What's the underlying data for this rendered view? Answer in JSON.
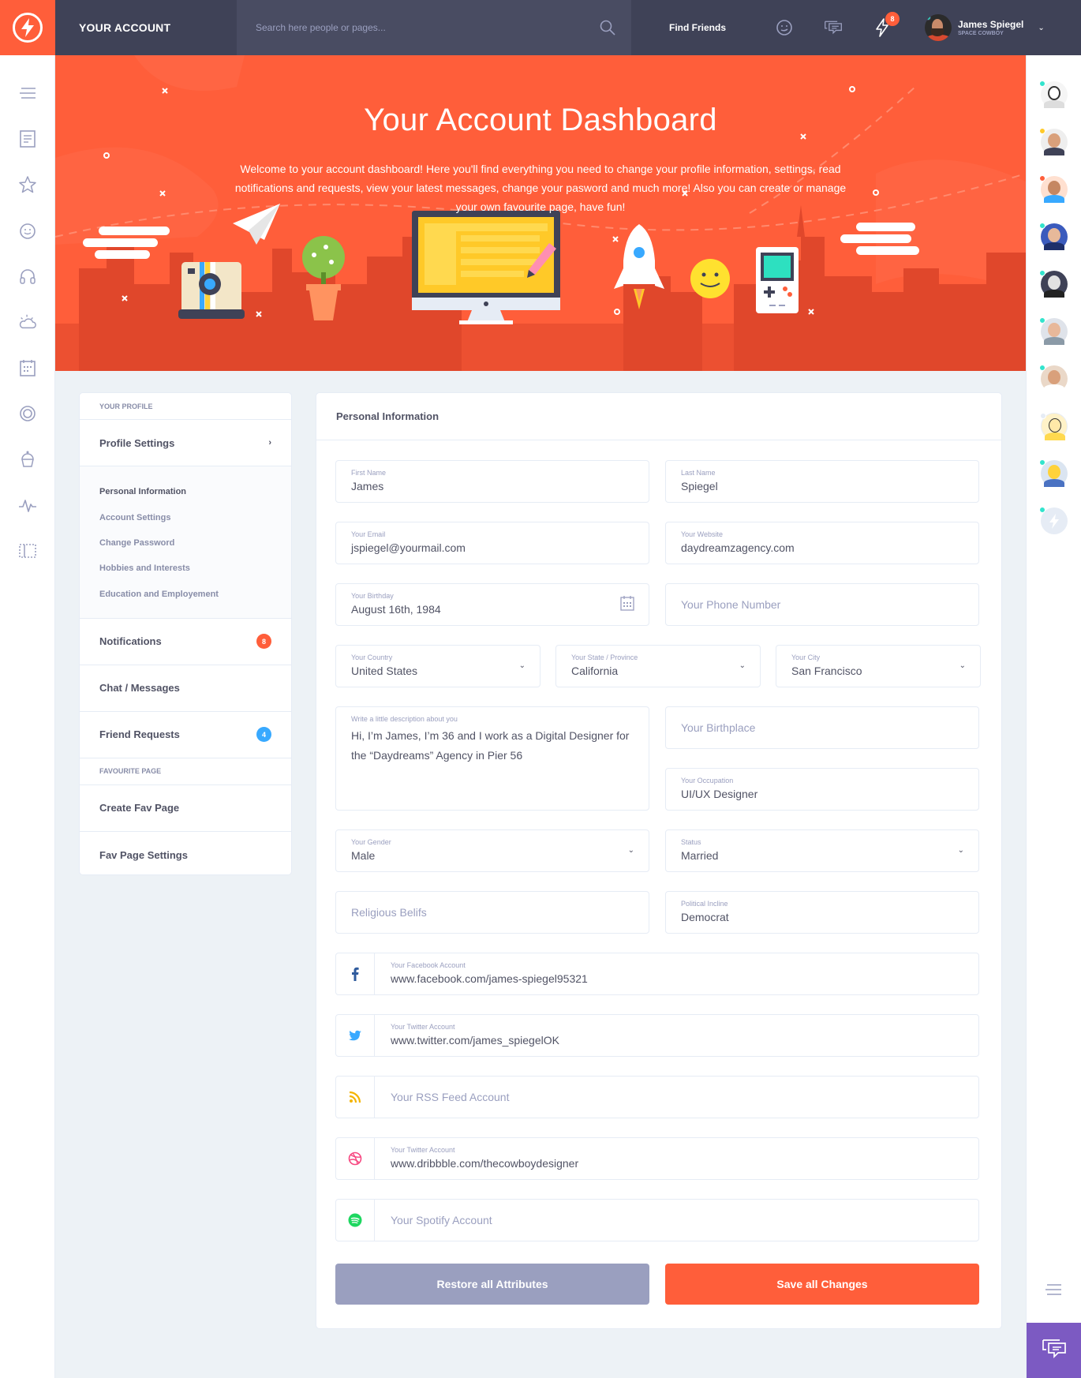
{
  "header": {
    "title": "YOUR ACCOUNT",
    "search_placeholder": "Search here people or pages...",
    "find_friends": "Find Friends",
    "notifications_count": "8",
    "user": {
      "name": "James Spiegel",
      "status": "SPACE COWBOY"
    }
  },
  "hero": {
    "title": "Your Account Dashboard",
    "text": "Welcome to your account dashboard! Here you'll find everything you need to change your profile information, settings, read notifications and requests, view your latest messages, change your pasword and much more! Also you can create or manage your own favourite page, have fun!"
  },
  "menu": {
    "section_profile": "YOUR PROFILE",
    "profile_settings": "Profile Settings",
    "sub_items": [
      "Personal Information",
      "Account Settings",
      "Change Password",
      "Hobbies and Interests",
      "Education and Employement"
    ],
    "notifications": "Notifications",
    "notifications_count": "8",
    "chat": "Chat / Messages",
    "friend_requests": "Friend Requests",
    "friend_requests_count": "4",
    "section_fav": "FAVOURITE PAGE",
    "create_fav": "Create Fav Page",
    "fav_settings": "Fav Page Settings"
  },
  "form": {
    "heading": "Personal Information",
    "first_name": {
      "label": "First Name",
      "value": "James"
    },
    "last_name": {
      "label": "Last Name",
      "value": "Spiegel"
    },
    "email": {
      "label": "Your Email",
      "value": "jspiegel@yourmail.com"
    },
    "website": {
      "label": "Your Website",
      "value": "daydreamzagency.com"
    },
    "birthday": {
      "label": "Your Birthday",
      "value": "August 16th, 1984"
    },
    "phone": {
      "placeholder": "Your Phone Number"
    },
    "country": {
      "label": "Your Country",
      "value": "United States"
    },
    "state": {
      "label": "Your State / Province",
      "value": "California"
    },
    "city": {
      "label": "Your City",
      "value": "San Francisco"
    },
    "description": {
      "label": "Write a little description about you",
      "value": "Hi, I’m James, I’m 36 and I work as a Digital Designer for the  “Daydreams” Agency in Pier 56"
    },
    "birthplace": {
      "placeholder": "Your Birthplace"
    },
    "occupation": {
      "label": "Your Occupation",
      "value": "UI/UX Designer"
    },
    "gender": {
      "label": "Your Gender",
      "value": "Male"
    },
    "status": {
      "label": "Status",
      "value": "Married"
    },
    "religious": {
      "placeholder": "Religious Belifs"
    },
    "political": {
      "label": "Political Incline",
      "value": "Democrat"
    },
    "facebook": {
      "label": "Your Facebook Account",
      "value": "www.facebook.com/james-spiegel95321"
    },
    "twitter": {
      "label": "Your Twitter Account",
      "value": "www.twitter.com/james_spiegelOK"
    },
    "rss": {
      "placeholder": "Your RSS Feed Account"
    },
    "dribbble": {
      "label": "Your Twitter Account",
      "value": "www.dribbble.com/thecowboydesigner"
    },
    "spotify": {
      "placeholder": "Your Spotify Account"
    },
    "restore_button": "Restore all Attributes",
    "save_button": "Save all Changes"
  },
  "colors": {
    "primary": "#ff5e3a",
    "header": "#3f4257",
    "purple": "#7c5ac2",
    "blue": "#38a9ff",
    "grey": "#9a9fbf"
  },
  "icons": [
    "lightning-logo-icon",
    "search-icon",
    "smiley-icon",
    "chat-bubbles-icon",
    "lightning-notification-icon",
    "menu-icon",
    "newsfeed-icon",
    "star-icon",
    "happy-face-icon",
    "headphones-icon",
    "weather-icon",
    "calendar-icon",
    "badge-icon",
    "cupcake-icon",
    "stats-icon",
    "manage-widgets-icon",
    "facebook-icon",
    "twitter-icon",
    "rss-icon",
    "dribbble-icon",
    "spotify-icon"
  ]
}
